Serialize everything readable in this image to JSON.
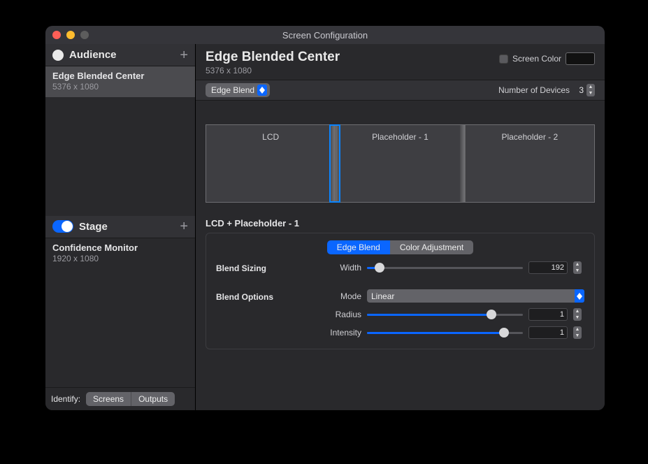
{
  "window_title": "Screen Configuration",
  "sidebar": {
    "audience": {
      "label": "Audience",
      "items": [
        {
          "title": "Edge Blended Center",
          "sub": "5376 x 1080"
        }
      ]
    },
    "stage": {
      "label": "Stage",
      "items": [
        {
          "title": "Confidence Monitor",
          "sub": "1920 x 1080"
        }
      ]
    },
    "identify": {
      "label": "Identify:",
      "screens": "Screens",
      "outputs": "Outputs"
    }
  },
  "main": {
    "title": "Edge Blended Center",
    "sub": "5376 x 1080",
    "screen_color_label": "Screen Color",
    "mode_popup": "Edge Blend",
    "devices_label": "Number of Devices",
    "devices_value": "3",
    "screens": [
      {
        "name": "LCD"
      },
      {
        "name": "Placeholder - 1"
      },
      {
        "name": "Placeholder - 2"
      }
    ],
    "selection_title": "LCD + Placeholder - 1",
    "tabs": {
      "edge_blend": "Edge Blend",
      "color_adj": "Color Adjustment"
    },
    "blend_sizing_label": "Blend Sizing",
    "blend_options_label": "Blend Options",
    "width_label": "Width",
    "width_value": "192",
    "mode_label": "Mode",
    "mode_value": "Linear",
    "radius_label": "Radius",
    "radius_value": "1",
    "intensity_label": "Intensity",
    "intensity_value": "1"
  }
}
